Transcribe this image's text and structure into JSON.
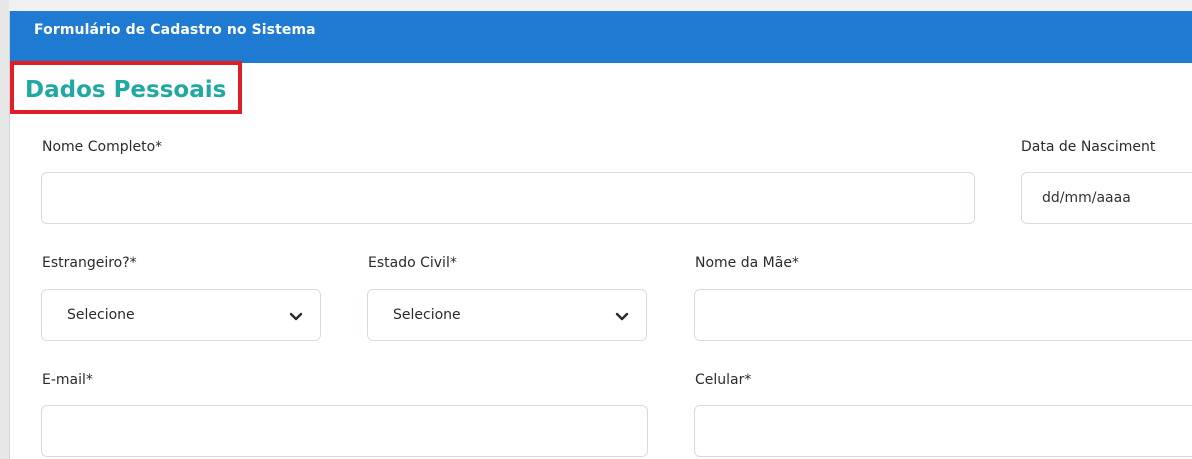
{
  "panel": {
    "title": "Formulário de Cadastro no Sistema",
    "section_title": "Dados Pessoais"
  },
  "fields": {
    "nome_completo": {
      "label": "Nome Completo*",
      "value": ""
    },
    "data_nascimento": {
      "label": "Data de Nasciment",
      "placeholder": "dd/mm/aaaa"
    },
    "estrangeiro": {
      "label": "Estrangeiro?*",
      "selected": "Selecione"
    },
    "estado_civil": {
      "label": "Estado Civil*",
      "selected": "Selecione"
    },
    "nome_mae": {
      "label": "Nome da Mãe*",
      "value": ""
    },
    "email": {
      "label": "E-mail*",
      "value": ""
    },
    "celular": {
      "label": "Celular*",
      "value": ""
    }
  },
  "icons": {
    "dropdown": "chevron-down-icon"
  },
  "colors": {
    "header": "#1f7ad1",
    "section_title": "#21a8a1",
    "highlight": "#e21d25",
    "field_border": "#d7dbe0"
  }
}
